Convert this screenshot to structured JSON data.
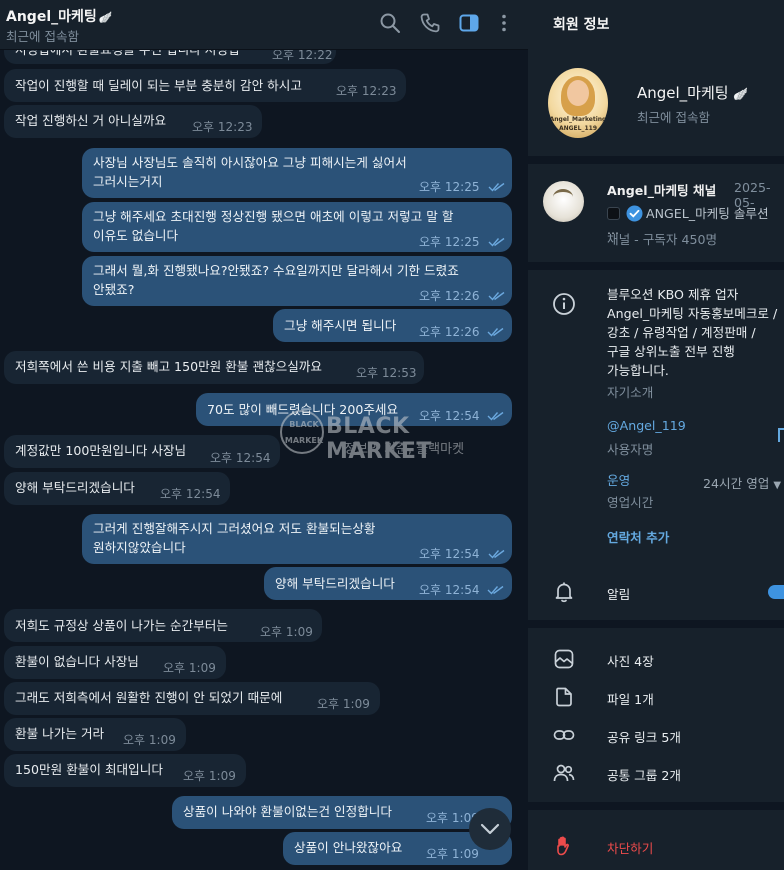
{
  "chat": {
    "title": "Angel_마케팅",
    "wings": "🪽",
    "status": "최근에 접속함",
    "messages": [
      {
        "dir": "in",
        "lines": [
          "저정됩에서 환불요청을 주신 접니다 저정됩"
        ],
        "time": "오후 12:22"
      },
      {
        "dir": "in",
        "lines": [
          "작업이 진행할 때 딜레이 되는 부분 충분히 감안 하시고"
        ],
        "time": "오후 12:23"
      },
      {
        "dir": "in",
        "lines": [
          "작업 진행하신 거 아니실까요"
        ],
        "time": "오후 12:23"
      },
      {
        "dir": "out",
        "lines": [
          "사장님 사장님도 솔직히 아시잖아요 그냥 피해시는게 싫어서",
          "그러시는거지"
        ],
        "time": "오후 12:25"
      },
      {
        "dir": "out",
        "lines": [
          "그냥 해주세요 초대진행 정상진행 됐으면 애초에 이렇고 저렇고 말 할",
          "이유도 없습니다"
        ],
        "time": "오후 12:25"
      },
      {
        "dir": "out",
        "lines": [
          "그래서 뭘,화 진행됐나요?안됐죠? 수요일까지만 달라해서 기한 드렸죠",
          "안됐죠?"
        ],
        "time": "오후 12:26"
      },
      {
        "dir": "out",
        "lines": [
          "그냥 해주시면 됩니다"
        ],
        "time": "오후 12:26"
      },
      {
        "dir": "in",
        "lines": [
          "저희쪽에서 쓴 비용 지출 빼고 150만원 환불 괜찮으실까요"
        ],
        "time": "오후 12:53"
      },
      {
        "dir": "out",
        "lines": [
          "70도 많이 빼드렸습니다 200주세요"
        ],
        "time": "오후 12:54"
      },
      {
        "dir": "in",
        "lines": [
          "계정값만 100만원입니다 사장님"
        ],
        "time": "오후 12:54"
      },
      {
        "dir": "in",
        "lines": [
          "양해 부탁드리겠습니다"
        ],
        "time": "오후 12:54"
      },
      {
        "dir": "out",
        "lines": [
          "그러게 진행잘해주시지 그러셨어요 저도 환불되는상황",
          "원하지않았습니다"
        ],
        "time": "오후 12:54"
      },
      {
        "dir": "out",
        "lines": [
          "양해 부탁드리겠습니다"
        ],
        "time": "오후 12:54"
      },
      {
        "dir": "in",
        "lines": [
          "저희도 규정상 상품이 나가는 순간부터는"
        ],
        "time": "오후 1:09"
      },
      {
        "dir": "in",
        "lines": [
          "환불이 없습니다 사장님"
        ],
        "time": "오후 1:09"
      },
      {
        "dir": "in",
        "lines": [
          "그래도 저희측에서 원활한 진행이 안 되었기 때문에"
        ],
        "time": "오후 1:09"
      },
      {
        "dir": "in",
        "lines": [
          "환불 나가는 거라"
        ],
        "time": "오후 1:09"
      },
      {
        "dir": "in",
        "lines": [
          "150만원 환불이 최대입니다"
        ],
        "time": "오후 1:09"
      },
      {
        "dir": "out",
        "lines": [
          "상품이 나와야 환불이없는건 인정합니다"
        ],
        "time": "오후 1:09"
      },
      {
        "dir": "out",
        "lines": [
          "상품이 안나왔잖아요"
        ],
        "time": "오후 1:09"
      }
    ]
  },
  "watermark": {
    "badge_top": "BLACK",
    "badge_bottom": "MARKEK",
    "title": "BLACK MARKET",
    "subtitle": "정보의 기준, 블랙마켓"
  },
  "profile": {
    "header": "회원 정보",
    "name": "Angel_마케팅",
    "wings": "🪽",
    "status": "최근에 접속함",
    "avatar_label_1": "Angel_Marketing",
    "avatar_label_2": "ANGEL_119",
    "channel": {
      "name": "Angel_마케팅 채널",
      "date": "2025-05-",
      "line": "ANGEL_마케팅 솔루션 ...",
      "subscribers": "채널 - 구독자 450명"
    },
    "bio": {
      "lines": [
        "블루오션 KBO 제휴 업자",
        "Angel_마케팅 자동홍보메크로 /",
        "강초 / 유령작업 / 계정판매 /",
        "구글 상위노출 전부 진행",
        "가능합니다."
      ],
      "label": "자기소개"
    },
    "username": {
      "value": "@Angel_119",
      "label": "사용자명"
    },
    "hours": {
      "value": "운영",
      "label": "영업시간",
      "right": "24시간 영업"
    },
    "contact_add": "연락처 추가",
    "notifications": "알림",
    "media": [
      {
        "icon": "photo-icon",
        "label": "사진 4장"
      },
      {
        "icon": "file-icon",
        "label": "파일 1개"
      },
      {
        "icon": "link-icon",
        "label": "공유 링크 5개"
      },
      {
        "icon": "group-icon",
        "label": "공통 그룹 2개"
      }
    ],
    "block": "차단하기"
  },
  "colors": {
    "incoming_bubble": "#182533",
    "outgoing_bubble": "#2b5278",
    "accent": "#64a9e0",
    "danger": "#ec4b4b"
  }
}
